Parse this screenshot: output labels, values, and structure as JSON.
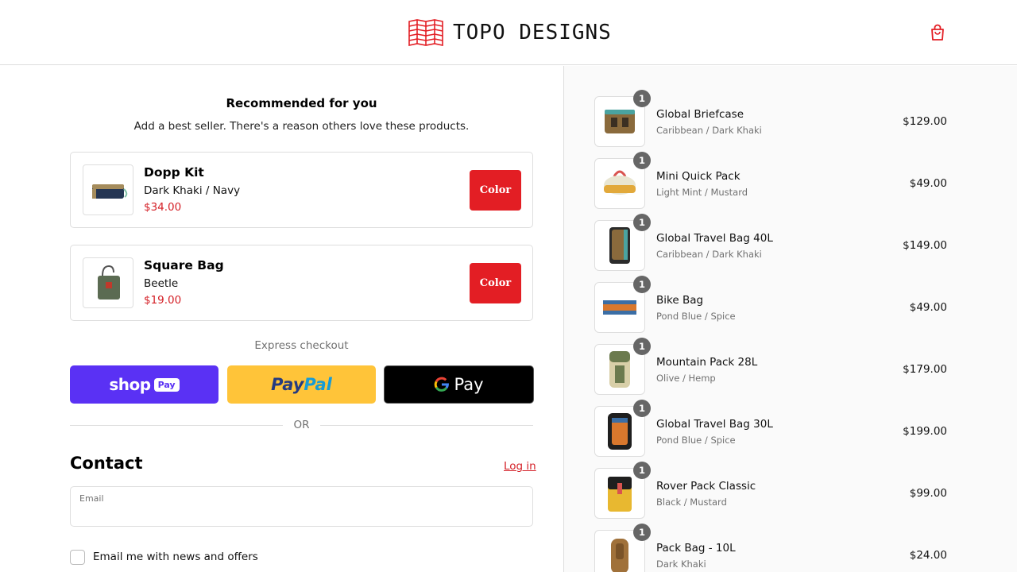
{
  "header": {
    "brand": "TOPO DESIGNS",
    "cart_icon": "shopping-bag-icon",
    "accent_color": "#e31e24"
  },
  "recommended": {
    "title": "Recommended for you",
    "subtitle": "Add a best seller. There's a reason others love these products.",
    "items": [
      {
        "name": "Dopp Kit",
        "variant": "Dark Khaki / Navy",
        "price": "$34.00",
        "button": "Color"
      },
      {
        "name": "Square Bag",
        "variant": "Beetle",
        "price": "$19.00",
        "button": "Color"
      }
    ]
  },
  "express": {
    "label": "Express checkout",
    "shop_pay": {
      "shop": "shop",
      "pay": "Pay"
    },
    "paypal": {
      "pay": "Pay",
      "pal": "Pal"
    },
    "gpay": {
      "g": "G",
      "pay": "Pay"
    },
    "or": "OR"
  },
  "contact": {
    "title": "Contact",
    "login": "Log in",
    "email_label": "Email",
    "email_value": "",
    "newsletter_label": "Email me with news and offers",
    "newsletter_checked": false
  },
  "order_summary": {
    "items": [
      {
        "name": "Global Briefcase",
        "variant": "Caribbean / Dark Khaki",
        "price": "$129.00",
        "quantity": "1"
      },
      {
        "name": "Mini Quick Pack",
        "variant": "Light Mint / Mustard",
        "price": "$49.00",
        "quantity": "1"
      },
      {
        "name": "Global Travel Bag 40L",
        "variant": "Caribbean / Dark Khaki",
        "price": "$149.00",
        "quantity": "1"
      },
      {
        "name": "Bike Bag",
        "variant": "Pond Blue / Spice",
        "price": "$49.00",
        "quantity": "1"
      },
      {
        "name": "Mountain Pack 28L",
        "variant": "Olive / Hemp",
        "price": "$179.00",
        "quantity": "1"
      },
      {
        "name": "Global Travel Bag 30L",
        "variant": "Pond Blue / Spice",
        "price": "$199.00",
        "quantity": "1"
      },
      {
        "name": "Rover Pack Classic",
        "variant": "Black / Mustard",
        "price": "$99.00",
        "quantity": "1"
      },
      {
        "name": "Pack Bag - 10L",
        "variant": "Dark Khaki",
        "price": "$24.00",
        "quantity": "1"
      }
    ]
  }
}
